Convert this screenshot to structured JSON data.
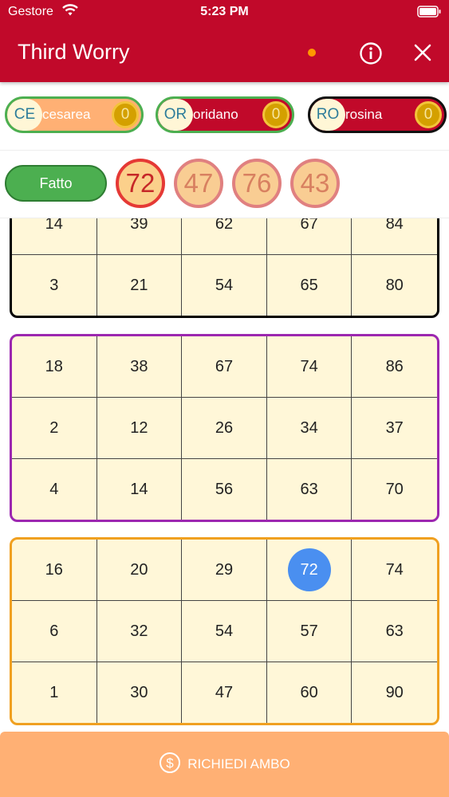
{
  "status_bar": {
    "carrier": "Gestore",
    "time": "5:23 PM"
  },
  "header": {
    "title": "Third Worry"
  },
  "players": [
    {
      "initials": "CE",
      "name": "cesarea",
      "score": "0",
      "name_bg": "#ffb074",
      "border": "#4caf50"
    },
    {
      "initials": "OR",
      "name": "oridano",
      "score": "0",
      "name_bg": "#c1092a",
      "border": "#4caf50"
    },
    {
      "initials": "RO",
      "name": "rosina",
      "score": "0",
      "name_bg": "#c1092a",
      "border": "#111111"
    }
  ],
  "done_button": "Fatto",
  "drawn_numbers": [
    "72",
    "47",
    "76",
    "43"
  ],
  "cards": [
    {
      "border": "#000000",
      "rows": [
        [
          "14",
          "39",
          "62",
          "67",
          "84"
        ],
        [
          "3",
          "21",
          "54",
          "65",
          "80"
        ]
      ]
    },
    {
      "border": "#9c27b0",
      "rows": [
        [
          "18",
          "38",
          "67",
          "74",
          "86"
        ],
        [
          "2",
          "12",
          "26",
          "34",
          "37"
        ],
        [
          "4",
          "14",
          "56",
          "63",
          "70"
        ]
      ]
    },
    {
      "border": "#f0a020",
      "rows": [
        [
          "16",
          "20",
          "29",
          "72",
          "74"
        ],
        [
          "6",
          "32",
          "54",
          "57",
          "63"
        ],
        [
          "1",
          "30",
          "47",
          "60",
          "90"
        ]
      ]
    }
  ],
  "marked_numbers": [
    "72"
  ],
  "action_button": "RICHIEDI AMBO",
  "colors": {
    "header": "#c1092a",
    "marked": "#4a8ff0",
    "action": "#ffb074"
  }
}
